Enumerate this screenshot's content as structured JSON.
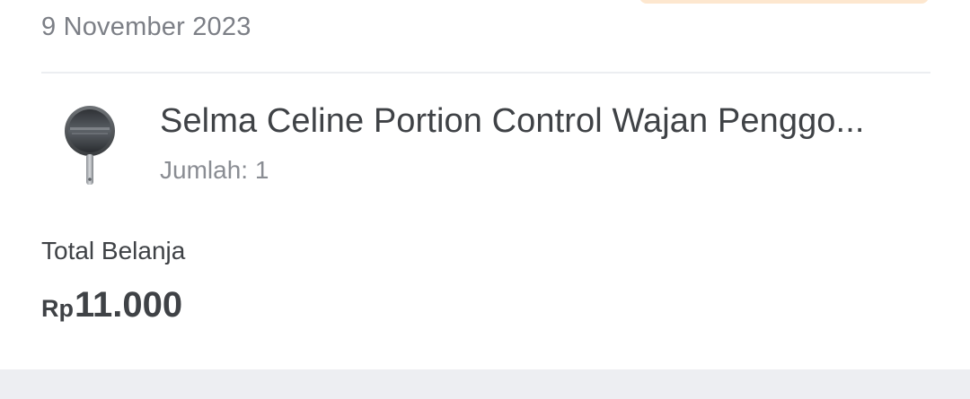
{
  "order": {
    "date": "9 November 2023",
    "status_badge_color": "#fde7cf",
    "item": {
      "name": "Selma Celine Portion Control Wajan Penggo...",
      "quantity_label": "Jumlah: 1",
      "thumbnail_icon": "frying-pan-icon"
    },
    "total": {
      "label": "Total Belanja",
      "currency": "Rp",
      "amount": "11.000"
    }
  },
  "colors": {
    "text_primary": "#3f4246",
    "text_secondary": "#7c7f86",
    "divider": "#eceef1",
    "footer_band": "#edeef2"
  }
}
